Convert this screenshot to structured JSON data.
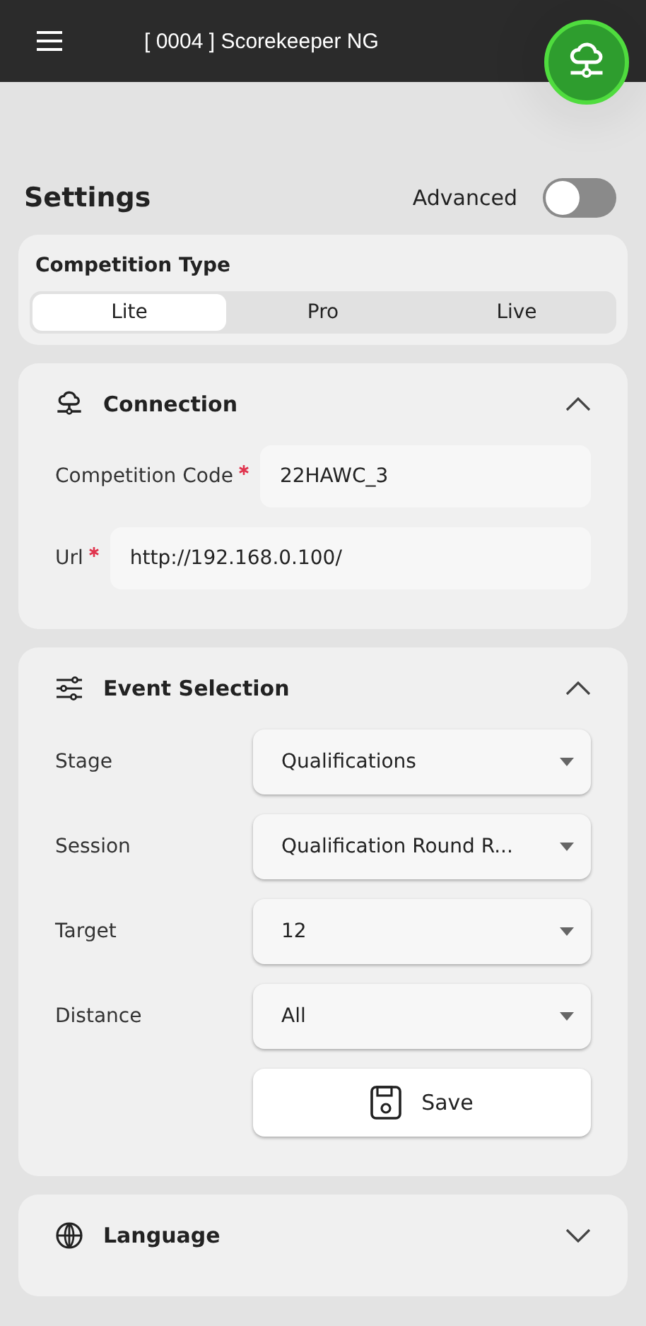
{
  "app_bar": {
    "title": "[ 0004 ] Scorekeeper NG"
  },
  "header": {
    "title": "Settings",
    "advanced": {
      "label": "Advanced",
      "on": false
    }
  },
  "competition_type": {
    "title": "Competition Type",
    "options": [
      {
        "label": "Lite",
        "selected": true
      },
      {
        "label": "Pro",
        "selected": false
      },
      {
        "label": "Live",
        "selected": false
      }
    ]
  },
  "sections": [
    {
      "kind": "connection",
      "title": "Connection",
      "expanded": true,
      "fields": [
        {
          "kind": "text",
          "label": "Competition Code",
          "required": true,
          "value": "22HAWC_3"
        },
        {
          "kind": "text",
          "label": "Url",
          "required": true,
          "value": "http://192.168.0.100/"
        }
      ]
    },
    {
      "kind": "event",
      "title": "Event Selection",
      "expanded": true,
      "fields": [
        {
          "kind": "select",
          "label": "Stage",
          "value": "Qualifications"
        },
        {
          "kind": "select",
          "label": "Session",
          "value": "Qualification Round R..."
        },
        {
          "kind": "select",
          "label": "Target",
          "value": "12"
        },
        {
          "kind": "select",
          "label": "Distance",
          "value": "All"
        }
      ],
      "button": "Save"
    },
    {
      "kind": "language",
      "title": "Language",
      "expanded": false
    }
  ]
}
